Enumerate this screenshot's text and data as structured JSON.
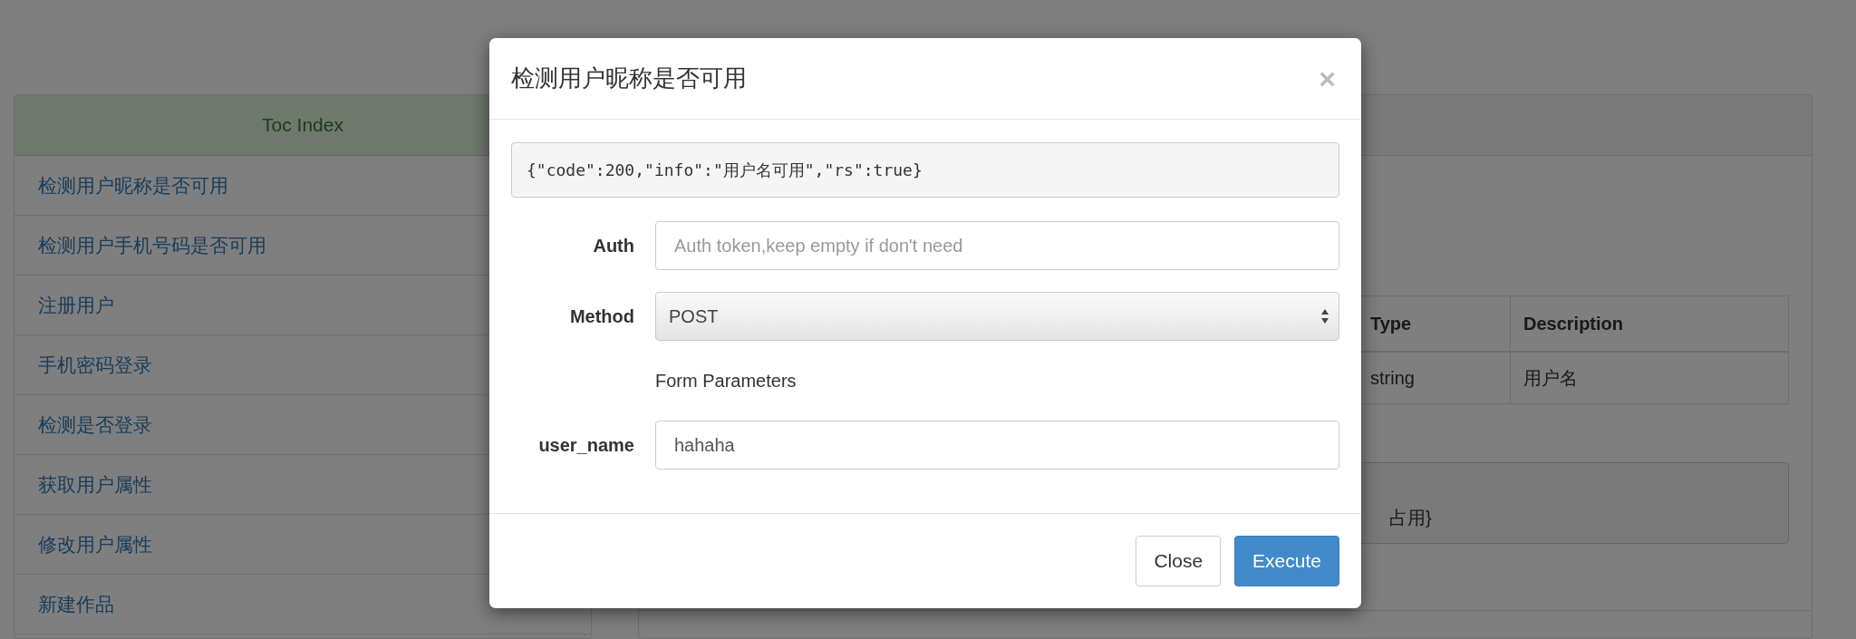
{
  "toc": {
    "title": "Toc Index",
    "items": [
      {
        "label": "检测用户昵称是否可用"
      },
      {
        "label": "检测用户手机号码是否可用"
      },
      {
        "label": "注册用户"
      },
      {
        "label": "手机密码登录"
      },
      {
        "label": "检测是否登录"
      },
      {
        "label": "获取用户属性"
      },
      {
        "label": "修改用户属性"
      },
      {
        "label": "新建作品"
      }
    ]
  },
  "content": {
    "table": {
      "columns": [
        "Type",
        "Description"
      ],
      "rows": [
        [
          "string",
          "用户名"
        ]
      ]
    },
    "response_fragment": "占用}"
  },
  "modal": {
    "title": "检测用户昵称是否可用",
    "close_glyph": "×",
    "response": "{\"code\":200,\"info\":\"用户名可用\",\"rs\":true}",
    "fields": [
      {
        "kind": "text",
        "label": "Auth",
        "placeholder": "Auth token,keep empty if don't need"
      },
      {
        "kind": "select",
        "label": "Method",
        "value": "POST"
      },
      {
        "kind": "section",
        "label": "Form Parameters"
      },
      {
        "kind": "text",
        "label": "user_name",
        "value": "hahaha"
      }
    ],
    "buttons": [
      {
        "label": "Close",
        "kind": "default"
      },
      {
        "label": "Execute",
        "kind": "primary"
      }
    ]
  }
}
